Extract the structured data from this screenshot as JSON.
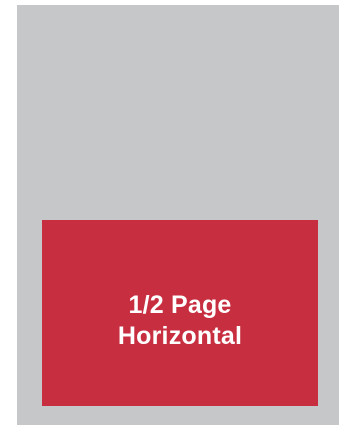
{
  "layout_diagram": {
    "page_color": "#c6c7c9",
    "ad_color": "#c72e3f",
    "label_color": "#ffffff",
    "label_lines": [
      "1/2 Page",
      "Horizontal"
    ]
  }
}
